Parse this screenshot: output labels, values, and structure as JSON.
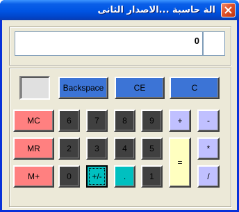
{
  "window": {
    "title": "الة حاسبة ...الاصدار الثانى"
  },
  "display": {
    "value": "0"
  },
  "buttons": {
    "backspace": "Backspace",
    "ce": "CE",
    "c": "C",
    "mc": "MC",
    "mr": "MR",
    "mplus": "M+",
    "d6": "6",
    "d7": "7",
    "d8": "8",
    "d9": "9",
    "d2": "2",
    "d3": "3",
    "d4": "4",
    "d5": "5",
    "d0": "0",
    "sign": "+/-",
    "dot": ".",
    "d1": "1",
    "plus": "+",
    "minus": "-",
    "multiply": "*",
    "divide": "/",
    "equals": "="
  },
  "colors": {
    "function_keys": "#3c74d6",
    "memory_keys": "#ff8080",
    "digit_keys": "#404040",
    "operator_keys": "#c0c0ff",
    "equals_key": "#ffffc0",
    "dot_key": "#00c0c0"
  }
}
